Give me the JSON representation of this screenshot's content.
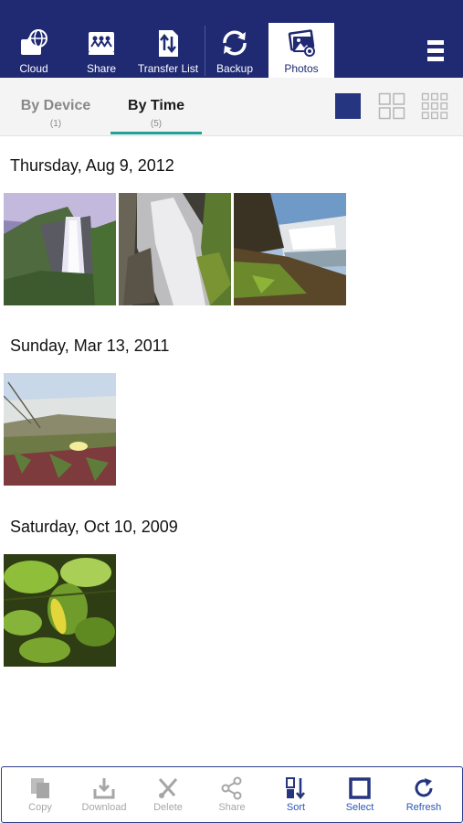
{
  "top_nav": {
    "tabs": [
      {
        "label": "Cloud",
        "icon": "cloud-folder-icon"
      },
      {
        "label": "Share",
        "icon": "share-users-icon"
      },
      {
        "label": "Transfer List",
        "icon": "transfer-list-icon"
      },
      {
        "label": "Backup",
        "icon": "backup-sync-icon"
      },
      {
        "label": "Photos",
        "icon": "photos-icon"
      }
    ],
    "active_tab": "Photos",
    "menu_icon": "hamburger-menu-icon",
    "colors": {
      "bar": "#1f2a72",
      "active_tab_bg": "#ffffff"
    }
  },
  "view_tabs": {
    "by_device": {
      "label": "By Device",
      "count": "(1)"
    },
    "by_time": {
      "label": "By Time",
      "count": "(5)"
    },
    "selected": "By Time",
    "underline_color": "#23a398"
  },
  "grid_options": [
    "single-column-icon",
    "four-grid-icon",
    "nine-grid-icon"
  ],
  "selected_grid": "single-column-icon",
  "groups": [
    {
      "date": "Thursday, Aug 9, 2012",
      "photos": [
        "waterfall-photo-1",
        "waterfall-photo-2",
        "waterfall-photo-3"
      ]
    },
    {
      "date": "Sunday, Mar 13, 2011",
      "photos": [
        "beach-flower-photo"
      ]
    },
    {
      "date": "Saturday, Oct 10, 2009",
      "photos": [
        "leaves-photo"
      ]
    }
  ],
  "toolbar": {
    "copy": "Copy",
    "download": "Download",
    "delete": "Delete",
    "share": "Share",
    "sort": "Sort",
    "select": "Select",
    "refresh": "Refresh",
    "enabled_color": "#2a58b8",
    "disabled_color": "#a6a6a6"
  }
}
